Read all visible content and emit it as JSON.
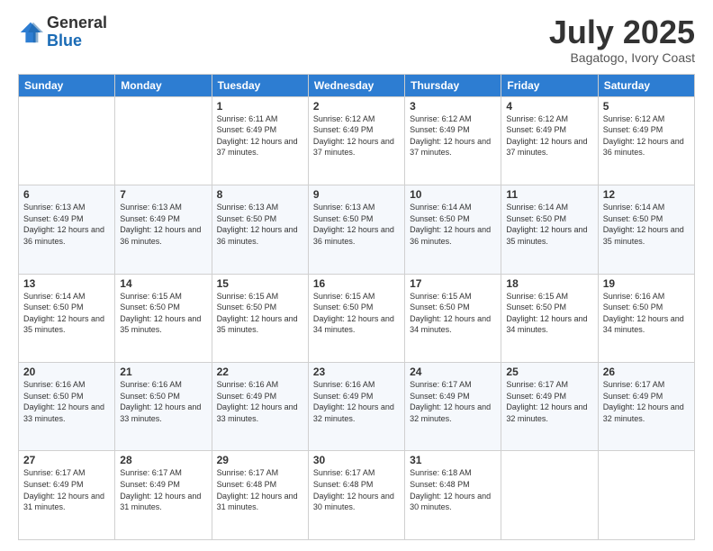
{
  "logo": {
    "general": "General",
    "blue": "Blue"
  },
  "header": {
    "month": "July 2025",
    "location": "Bagatogo, Ivory Coast"
  },
  "weekdays": [
    "Sunday",
    "Monday",
    "Tuesday",
    "Wednesday",
    "Thursday",
    "Friday",
    "Saturday"
  ],
  "weeks": [
    [
      {
        "day": "",
        "sunrise": "",
        "sunset": "",
        "daylight": ""
      },
      {
        "day": "",
        "sunrise": "",
        "sunset": "",
        "daylight": ""
      },
      {
        "day": "1",
        "sunrise": "Sunrise: 6:11 AM",
        "sunset": "Sunset: 6:49 PM",
        "daylight": "Daylight: 12 hours and 37 minutes."
      },
      {
        "day": "2",
        "sunrise": "Sunrise: 6:12 AM",
        "sunset": "Sunset: 6:49 PM",
        "daylight": "Daylight: 12 hours and 37 minutes."
      },
      {
        "day": "3",
        "sunrise": "Sunrise: 6:12 AM",
        "sunset": "Sunset: 6:49 PM",
        "daylight": "Daylight: 12 hours and 37 minutes."
      },
      {
        "day": "4",
        "sunrise": "Sunrise: 6:12 AM",
        "sunset": "Sunset: 6:49 PM",
        "daylight": "Daylight: 12 hours and 37 minutes."
      },
      {
        "day": "5",
        "sunrise": "Sunrise: 6:12 AM",
        "sunset": "Sunset: 6:49 PM",
        "daylight": "Daylight: 12 hours and 36 minutes."
      }
    ],
    [
      {
        "day": "6",
        "sunrise": "Sunrise: 6:13 AM",
        "sunset": "Sunset: 6:49 PM",
        "daylight": "Daylight: 12 hours and 36 minutes."
      },
      {
        "day": "7",
        "sunrise": "Sunrise: 6:13 AM",
        "sunset": "Sunset: 6:49 PM",
        "daylight": "Daylight: 12 hours and 36 minutes."
      },
      {
        "day": "8",
        "sunrise": "Sunrise: 6:13 AM",
        "sunset": "Sunset: 6:50 PM",
        "daylight": "Daylight: 12 hours and 36 minutes."
      },
      {
        "day": "9",
        "sunrise": "Sunrise: 6:13 AM",
        "sunset": "Sunset: 6:50 PM",
        "daylight": "Daylight: 12 hours and 36 minutes."
      },
      {
        "day": "10",
        "sunrise": "Sunrise: 6:14 AM",
        "sunset": "Sunset: 6:50 PM",
        "daylight": "Daylight: 12 hours and 36 minutes."
      },
      {
        "day": "11",
        "sunrise": "Sunrise: 6:14 AM",
        "sunset": "Sunset: 6:50 PM",
        "daylight": "Daylight: 12 hours and 35 minutes."
      },
      {
        "day": "12",
        "sunrise": "Sunrise: 6:14 AM",
        "sunset": "Sunset: 6:50 PM",
        "daylight": "Daylight: 12 hours and 35 minutes."
      }
    ],
    [
      {
        "day": "13",
        "sunrise": "Sunrise: 6:14 AM",
        "sunset": "Sunset: 6:50 PM",
        "daylight": "Daylight: 12 hours and 35 minutes."
      },
      {
        "day": "14",
        "sunrise": "Sunrise: 6:15 AM",
        "sunset": "Sunset: 6:50 PM",
        "daylight": "Daylight: 12 hours and 35 minutes."
      },
      {
        "day": "15",
        "sunrise": "Sunrise: 6:15 AM",
        "sunset": "Sunset: 6:50 PM",
        "daylight": "Daylight: 12 hours and 35 minutes."
      },
      {
        "day": "16",
        "sunrise": "Sunrise: 6:15 AM",
        "sunset": "Sunset: 6:50 PM",
        "daylight": "Daylight: 12 hours and 34 minutes."
      },
      {
        "day": "17",
        "sunrise": "Sunrise: 6:15 AM",
        "sunset": "Sunset: 6:50 PM",
        "daylight": "Daylight: 12 hours and 34 minutes."
      },
      {
        "day": "18",
        "sunrise": "Sunrise: 6:15 AM",
        "sunset": "Sunset: 6:50 PM",
        "daylight": "Daylight: 12 hours and 34 minutes."
      },
      {
        "day": "19",
        "sunrise": "Sunrise: 6:16 AM",
        "sunset": "Sunset: 6:50 PM",
        "daylight": "Daylight: 12 hours and 34 minutes."
      }
    ],
    [
      {
        "day": "20",
        "sunrise": "Sunrise: 6:16 AM",
        "sunset": "Sunset: 6:50 PM",
        "daylight": "Daylight: 12 hours and 33 minutes."
      },
      {
        "day": "21",
        "sunrise": "Sunrise: 6:16 AM",
        "sunset": "Sunset: 6:50 PM",
        "daylight": "Daylight: 12 hours and 33 minutes."
      },
      {
        "day": "22",
        "sunrise": "Sunrise: 6:16 AM",
        "sunset": "Sunset: 6:49 PM",
        "daylight": "Daylight: 12 hours and 33 minutes."
      },
      {
        "day": "23",
        "sunrise": "Sunrise: 6:16 AM",
        "sunset": "Sunset: 6:49 PM",
        "daylight": "Daylight: 12 hours and 32 minutes."
      },
      {
        "day": "24",
        "sunrise": "Sunrise: 6:17 AM",
        "sunset": "Sunset: 6:49 PM",
        "daylight": "Daylight: 12 hours and 32 minutes."
      },
      {
        "day": "25",
        "sunrise": "Sunrise: 6:17 AM",
        "sunset": "Sunset: 6:49 PM",
        "daylight": "Daylight: 12 hours and 32 minutes."
      },
      {
        "day": "26",
        "sunrise": "Sunrise: 6:17 AM",
        "sunset": "Sunset: 6:49 PM",
        "daylight": "Daylight: 12 hours and 32 minutes."
      }
    ],
    [
      {
        "day": "27",
        "sunrise": "Sunrise: 6:17 AM",
        "sunset": "Sunset: 6:49 PM",
        "daylight": "Daylight: 12 hours and 31 minutes."
      },
      {
        "day": "28",
        "sunrise": "Sunrise: 6:17 AM",
        "sunset": "Sunset: 6:49 PM",
        "daylight": "Daylight: 12 hours and 31 minutes."
      },
      {
        "day": "29",
        "sunrise": "Sunrise: 6:17 AM",
        "sunset": "Sunset: 6:48 PM",
        "daylight": "Daylight: 12 hours and 31 minutes."
      },
      {
        "day": "30",
        "sunrise": "Sunrise: 6:17 AM",
        "sunset": "Sunset: 6:48 PM",
        "daylight": "Daylight: 12 hours and 30 minutes."
      },
      {
        "day": "31",
        "sunrise": "Sunrise: 6:18 AM",
        "sunset": "Sunset: 6:48 PM",
        "daylight": "Daylight: 12 hours and 30 minutes."
      },
      {
        "day": "",
        "sunrise": "",
        "sunset": "",
        "daylight": ""
      },
      {
        "day": "",
        "sunrise": "",
        "sunset": "",
        "daylight": ""
      }
    ]
  ]
}
